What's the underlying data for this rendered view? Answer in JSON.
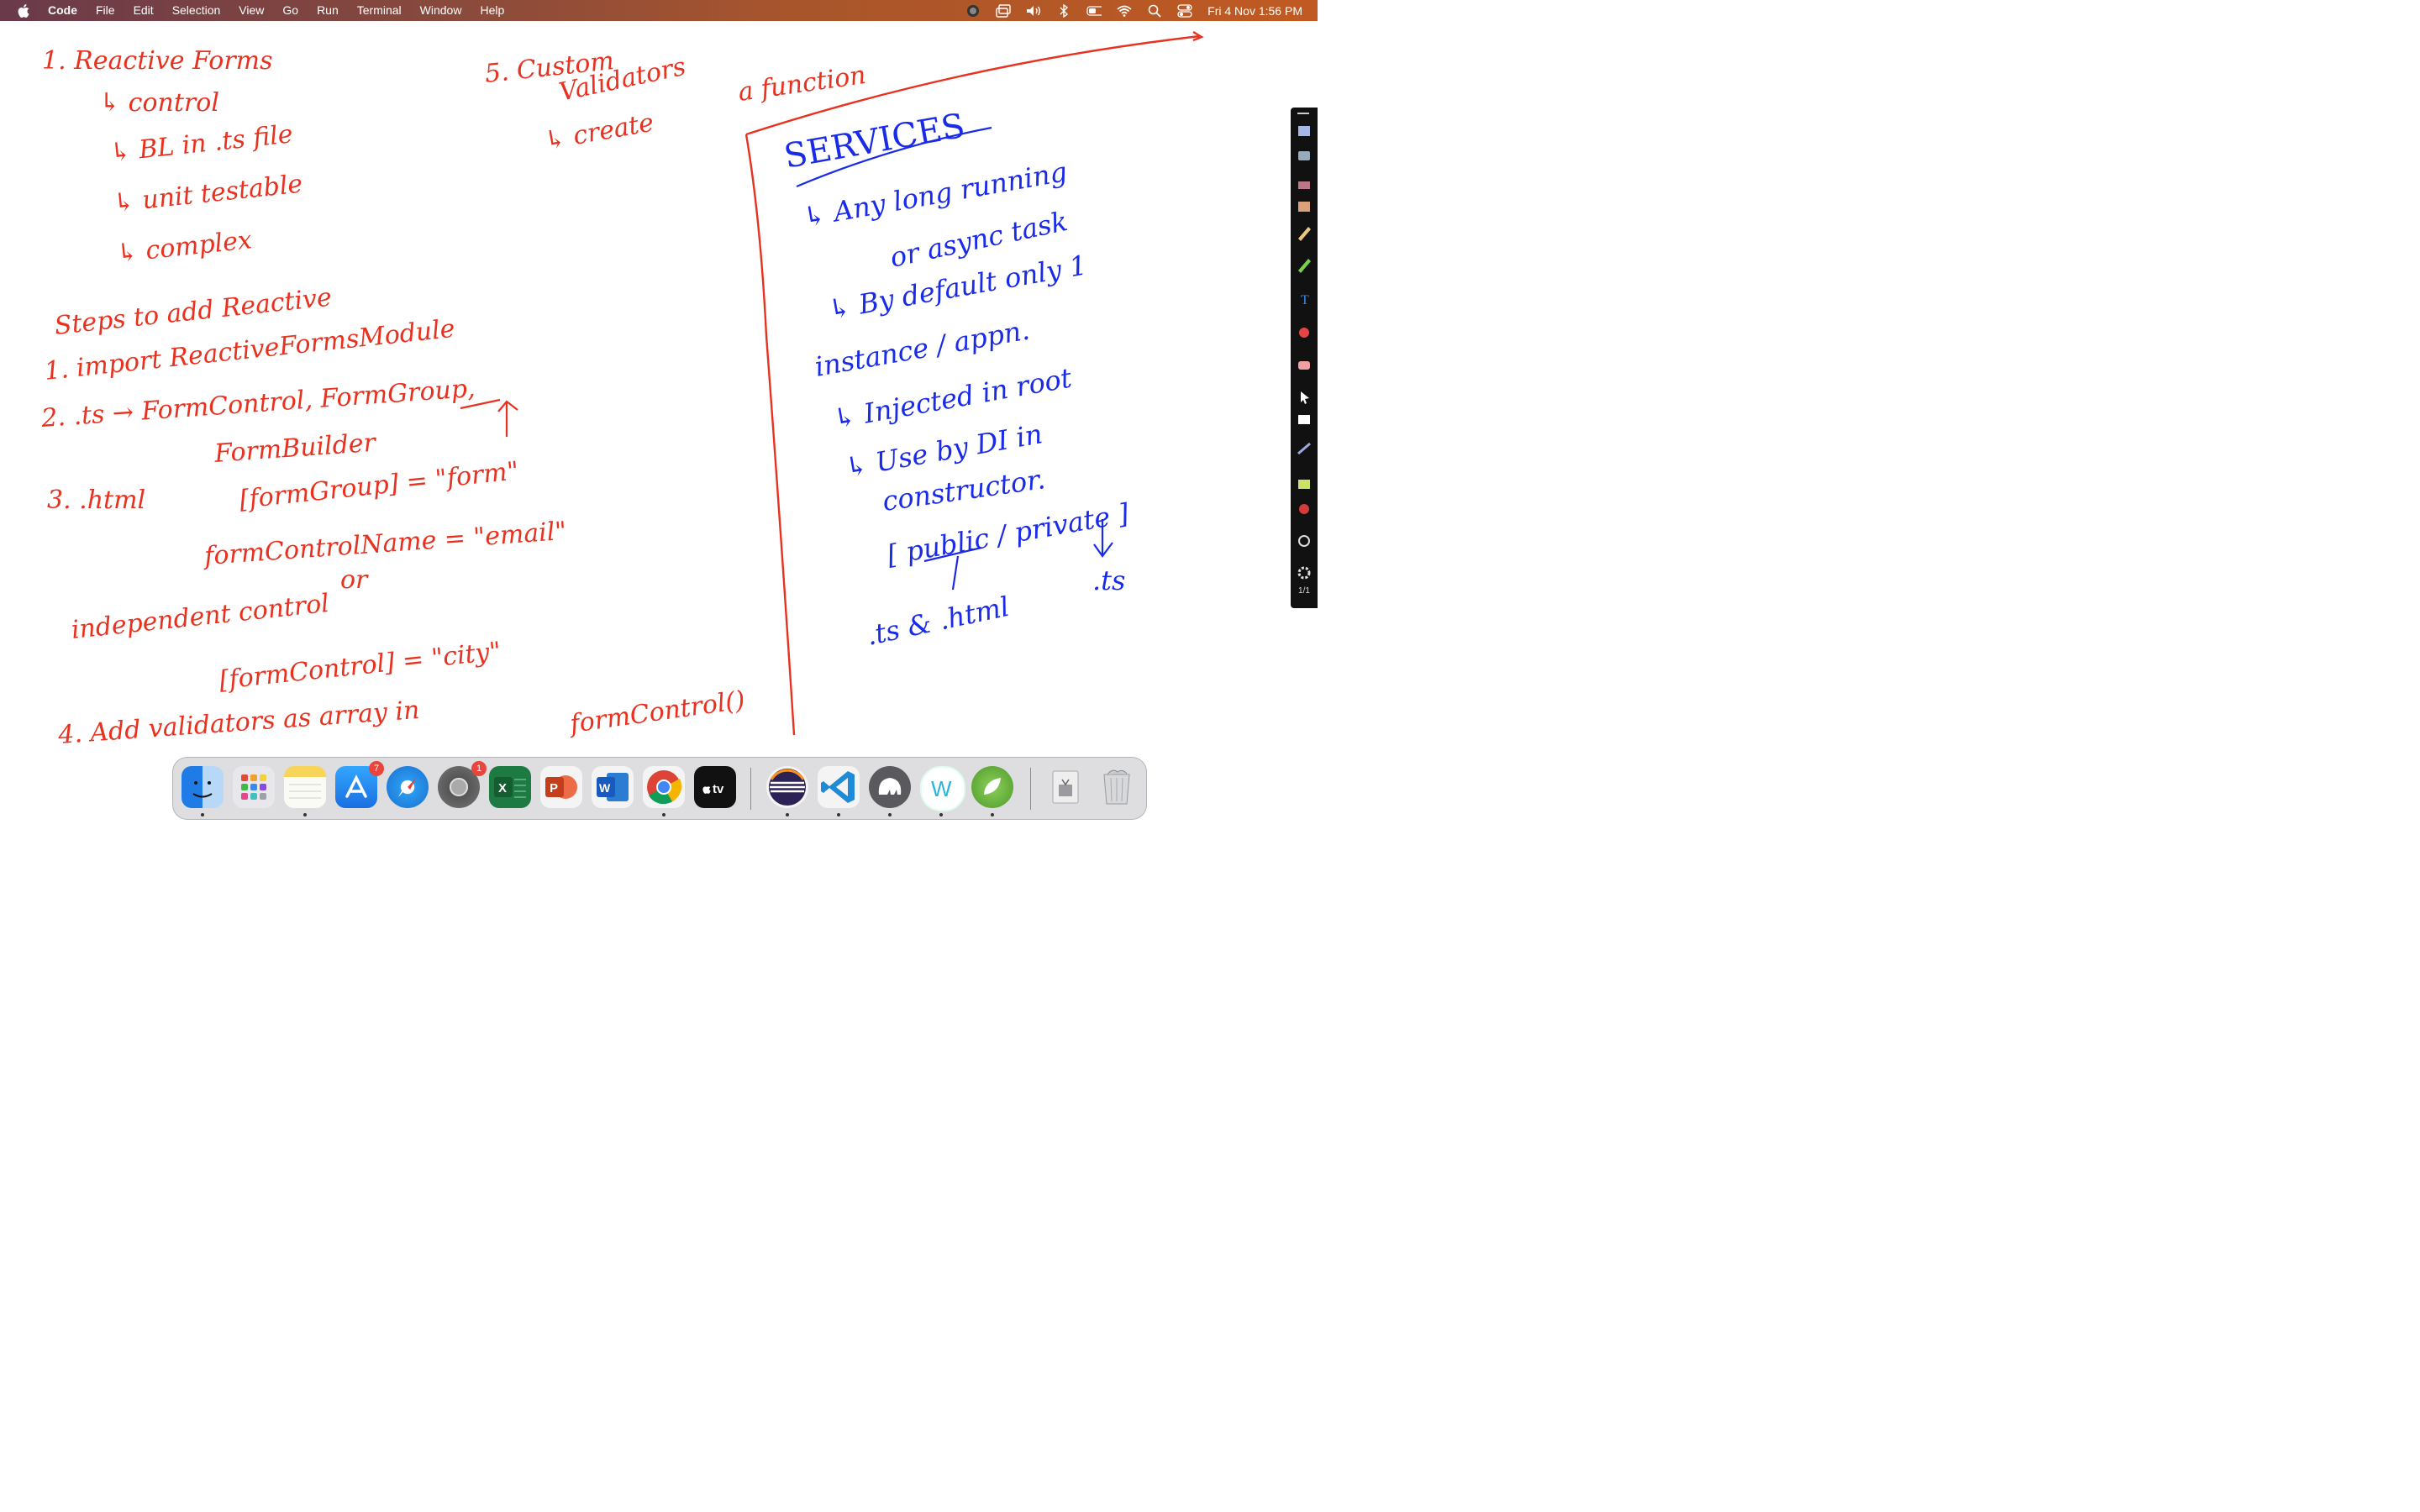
{
  "menubar": {
    "app_name": "Code",
    "menus": [
      "File",
      "Edit",
      "Selection",
      "View",
      "Go",
      "Run",
      "Terminal",
      "Window",
      "Help"
    ],
    "clock": "Fri 4 Nov  1:56 PM",
    "status_icons": [
      "siri-icon",
      "display-mirroring-icon",
      "volume-icon",
      "bluetooth-icon",
      "battery-icon",
      "wifi-icon",
      "spotlight-search-icon",
      "control-center-icon"
    ]
  },
  "notes": {
    "ink_red": "#e8311f",
    "ink_blue": "#1a2be8",
    "reactive_forms": {
      "title": "1. Reactive Forms",
      "bullets": [
        "↳ control",
        "↳ BL in .ts file",
        "↳ unit testable",
        "↳ complex"
      ]
    },
    "custom_validators": {
      "title": "5. Custom",
      "subtitle": "Validators",
      "bullet": "↳ create",
      "tail": "a function"
    },
    "steps": {
      "heading": "Steps to add Reactive",
      "step1": "1. import   ReactiveFormsModule",
      "step2": "2. .ts →   FormControl, FormGroup,",
      "step2b": "FormBuilder",
      "step3": "3. .html",
      "step3a": "[formGroup] = \"form\"",
      "step3b": "formControlName = \"email\"",
      "or": "or",
      "independent": "independent control",
      "step3c": "[formControl] = \"city\"",
      "step4": "4. Add   validators  as  array  in",
      "step4b": "formControl()"
    },
    "services": {
      "title": "SERVICES",
      "lines": [
        "↳ Any  long  running",
        "or  async  task",
        "↳ By default only 1",
        "instance / appn.",
        "↳ Injected  in  root",
        "↳ Use  by  DI  in",
        "constructor.",
        "[ public / private ]",
        ".ts",
        ".ts & .html"
      ]
    }
  },
  "toolbar": {
    "tools": [
      "minimize-icon",
      "screenshot-icon",
      "camera-icon",
      "eraser-icon",
      "palette-icon",
      "pen-icon",
      "highlighter-icon",
      "text-icon",
      "shapes-icon",
      "eraser-icon-2",
      "cursor-icon",
      "whiteboard-icon",
      "line-tool-icon",
      "fill-color-icon",
      "record-icon",
      "webcam-icon",
      "settings-icon"
    ],
    "page_counter": "1/1"
  },
  "dock": {
    "apps": [
      {
        "name": "finder",
        "color": "#3a8be8",
        "badge": ""
      },
      {
        "name": "launchpad",
        "color": "#e8e8ec",
        "badge": ""
      },
      {
        "name": "notes",
        "color": "#f6d55a",
        "badge": ""
      },
      {
        "name": "app-store",
        "color": "#1f8cf2",
        "badge": "7"
      },
      {
        "name": "safari",
        "color": "#2a9af0",
        "badge": ""
      },
      {
        "name": "system-preferences",
        "color": "#6e6e73",
        "badge": "1"
      },
      {
        "name": "excel",
        "color": "#1e7a43",
        "badge": ""
      },
      {
        "name": "powerpoint",
        "color": "#d2502b",
        "badge": ""
      },
      {
        "name": "word",
        "color": "#2a5cb4",
        "badge": ""
      },
      {
        "name": "chrome",
        "color": "#ffffff",
        "badge": ""
      },
      {
        "name": "apple-tv",
        "color": "#111111",
        "badge": ""
      },
      {
        "name": "eclipse",
        "color": "#2c2255",
        "badge": ""
      },
      {
        "name": "vscode",
        "color": "#1f8ad6",
        "badge": ""
      },
      {
        "name": "mamp",
        "color": "#5a5a5e",
        "badge": ""
      },
      {
        "name": "webstorm",
        "color": "#ffffff",
        "badge": ""
      },
      {
        "name": "spring-tool-suite",
        "color": "#6db33f",
        "badge": ""
      },
      {
        "name": "downloads",
        "color": "#e3e3e6",
        "badge": ""
      },
      {
        "name": "trash",
        "color": "#cfd0d4",
        "badge": ""
      }
    ],
    "appletv_label": "tv"
  }
}
